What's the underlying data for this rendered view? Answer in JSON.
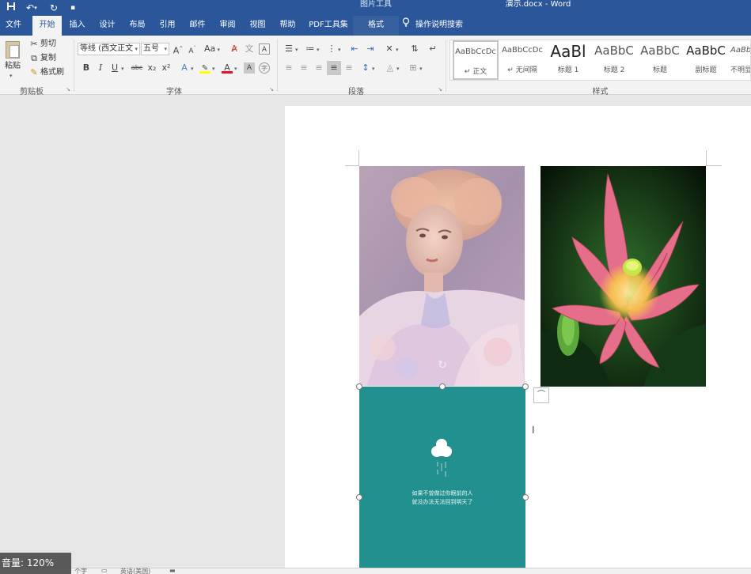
{
  "titlebar": {
    "context_tab_group": "图片工具",
    "document_title": "演示.docx  -  Word",
    "quick_access": [
      "save",
      "undo",
      "redo",
      "customize"
    ]
  },
  "tabs": [
    {
      "label": "文件"
    },
    {
      "label": "开始"
    },
    {
      "label": "插入"
    },
    {
      "label": "设计"
    },
    {
      "label": "布局"
    },
    {
      "label": "引用"
    },
    {
      "label": "邮件"
    },
    {
      "label": "审阅"
    },
    {
      "label": "视图"
    },
    {
      "label": "帮助"
    },
    {
      "label": "PDF工具集"
    },
    {
      "label": "格式"
    }
  ],
  "active_tab": "开始",
  "tell_me": "操作说明搜索",
  "clipboard": {
    "paste": "粘贴",
    "cut": "剪切",
    "copy": "复制",
    "format_painter": "格式刷",
    "group": "剪贴板"
  },
  "font": {
    "font_name": "等线 (西文正文",
    "font_size": "五号",
    "grow": "A",
    "shrink": "A",
    "change_case": "Aa",
    "bold": "B",
    "italic": "I",
    "underline": "U",
    "strikethrough": "abc",
    "subscript": "x₂",
    "superscript": "x²",
    "group": "字体"
  },
  "paragraph": {
    "group": "段落"
  },
  "styles": {
    "group": "样式",
    "items": [
      {
        "sample": "AaBbCcDc",
        "name": "↵ 正文"
      },
      {
        "sample": "AaBbCcDc",
        "name": "↵ 无间隔"
      },
      {
        "sample": "AaBl",
        "name": "标题 1"
      },
      {
        "sample": "AaBbC",
        "name": "标题 2"
      },
      {
        "sample": "AaBbC",
        "name": "标题"
      },
      {
        "sample": "AaBbC",
        "name": "副标题"
      },
      {
        "sample": "AaBbC",
        "name": "不明显"
      }
    ]
  },
  "document": {
    "images": [
      {
        "subject": "portrait-painting"
      },
      {
        "subject": "lotus-flower"
      },
      {
        "subject": "teal-cloud-graphic",
        "caption_line1": "如果不曾做过你眼前的人",
        "caption_line2": "就没办法无法回到明天了"
      }
    ]
  },
  "status": {
    "words": "个字",
    "language": "英语(美国)"
  },
  "overlay": {
    "volume": "音量: 120%"
  },
  "colors": {
    "brand": "#2b579a",
    "teal": "#22908f",
    "font_color_bar": "#e81123",
    "highlight_bar": "#ffff00"
  }
}
